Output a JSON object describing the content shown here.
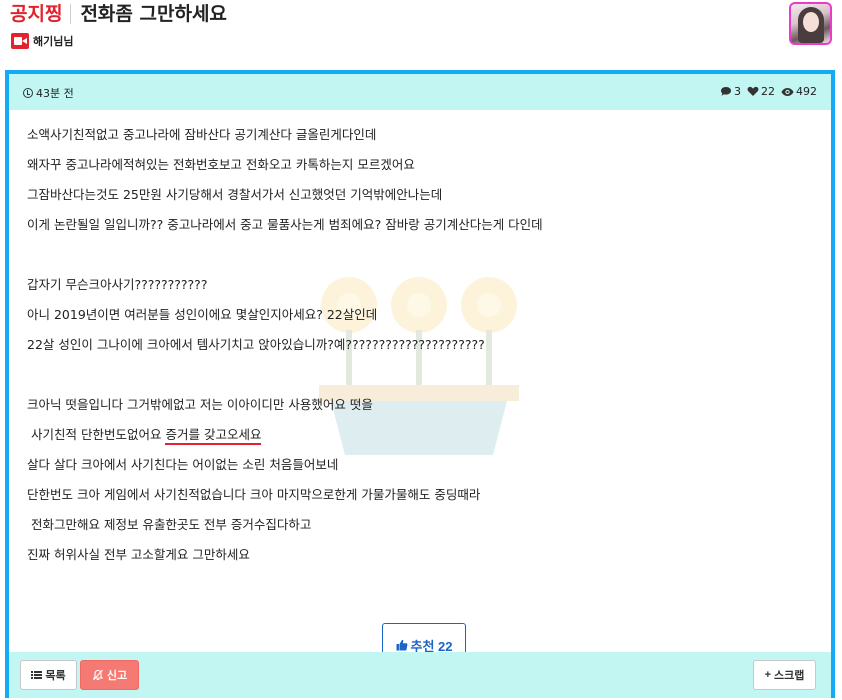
{
  "header": {
    "category": "공지찡",
    "title": "전화좀 그만하세요",
    "author": "해기님님"
  },
  "meta": {
    "time": "43분 전",
    "comments": "3",
    "likes": "22",
    "views": "492"
  },
  "content": {
    "lines": [
      "소액사기친적없고 중고나라에 잠바산다 공기계산다 글올린게다인데",
      "왜자꾸 중고나라에적혀있는 전화번호보고 전화오고 카톡하는지 모르겠어요",
      "그잠바산다는것도 25만원 사기당해서 경찰서가서 신고했엇던 기억밖에안나는데",
      "이게 논란될일 일입니까?? 중고나라에서 중고 물품사는게 범죄에요? 잠바랑 공기계산다는게 다인데",
      "갑자기 무슨크아사기???????????",
      "아니 2019년이면 여러분들 성인이에요 몇살인지아세요? 22살인데",
      "22살 성인이 그나이에 크아에서 템사기치고 앉아있습니까?예?????????????????????",
      "크아닉 떳을입니다 그거밖에없고 저는 이아이디만 사용했어요 떳을",
      "사기친적 단한번도없어요",
      "증거를 갖고오세요",
      "살다 살다 크아에서 사기친다는 어이없는 소린 처음들어보네",
      "단한번도 크아 게임에서 사기친적없습니다 크아 마지막으로한게 가물가물해도 중딩때라",
      "전화그만해요 제정보 유출한곳도 전부 증거수집다하고",
      "진짜 허위사실 전부 고소할게요 그만하세요"
    ]
  },
  "actions": {
    "recommend": "추천 22",
    "list": "목록",
    "report": "신고",
    "scrap": "스크랩"
  },
  "colors": {
    "accent_red": "#e0232f",
    "panel_border": "#14aaf5",
    "panel_bar": "#c2f6f3",
    "recommend_blue": "#1b64c8",
    "report_red": "#f47a73"
  }
}
